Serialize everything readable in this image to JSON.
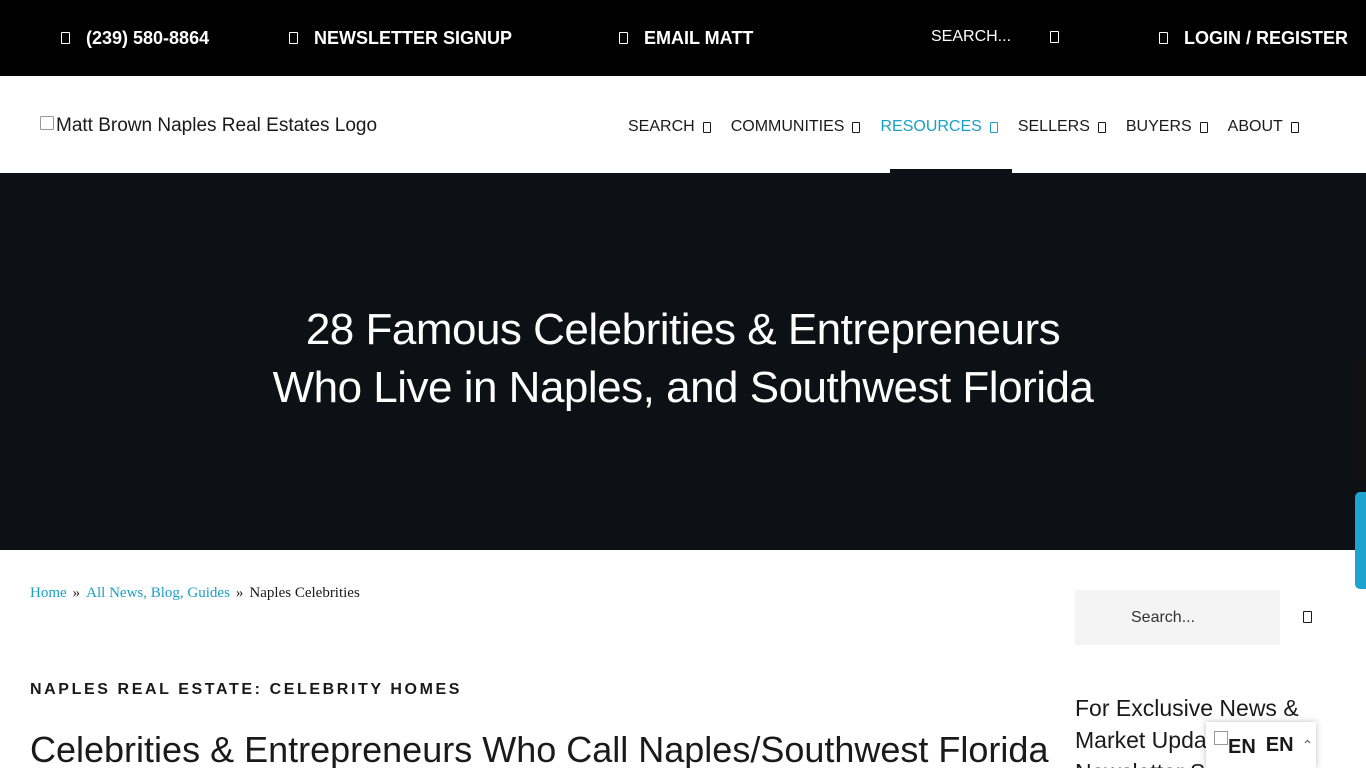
{
  "topbar": {
    "phone": "(239) 580-8864",
    "newsletter": "NEWSLETTER SIGNUP",
    "email": "EMAIL MATT",
    "search_placeholder": "SEARCH...",
    "login": "LOGIN / REGISTER"
  },
  "header": {
    "logo_alt": "Matt Brown Naples Real Estates Logo",
    "nav": [
      {
        "label": "SEARCH"
      },
      {
        "label": "COMMUNITIES"
      },
      {
        "label": "RESOURCES",
        "active": true
      },
      {
        "label": "SELLERS"
      },
      {
        "label": "BUYERS"
      },
      {
        "label": "ABOUT"
      }
    ]
  },
  "hero": {
    "title_line1": "28 Famous Celebrities & Entrepreneurs",
    "title_line2": "Who Live in Naples, and Southwest Florida"
  },
  "breadcrumb": {
    "home": "Home",
    "sep": "»",
    "blog": "All News, Blog, Guides",
    "current": "Naples Celebrities"
  },
  "article": {
    "kicker": "NAPLES REAL ESTATE: CELEBRITY HOMES",
    "heading": "Celebrities & Entrepreneurs Who Call Naples/Southwest Florida"
  },
  "sidebar": {
    "search_placeholder": "Search...",
    "newsletter_text": "For Exclusive News & Market Updates, Newsletter Signup"
  },
  "language": {
    "flag_text": "EN",
    "code": "EN",
    "caret": "⌃"
  },
  "colors": {
    "accent": "#1a9fc7",
    "topbar_bg": "#000000",
    "hero_bg": "#0d1014"
  }
}
